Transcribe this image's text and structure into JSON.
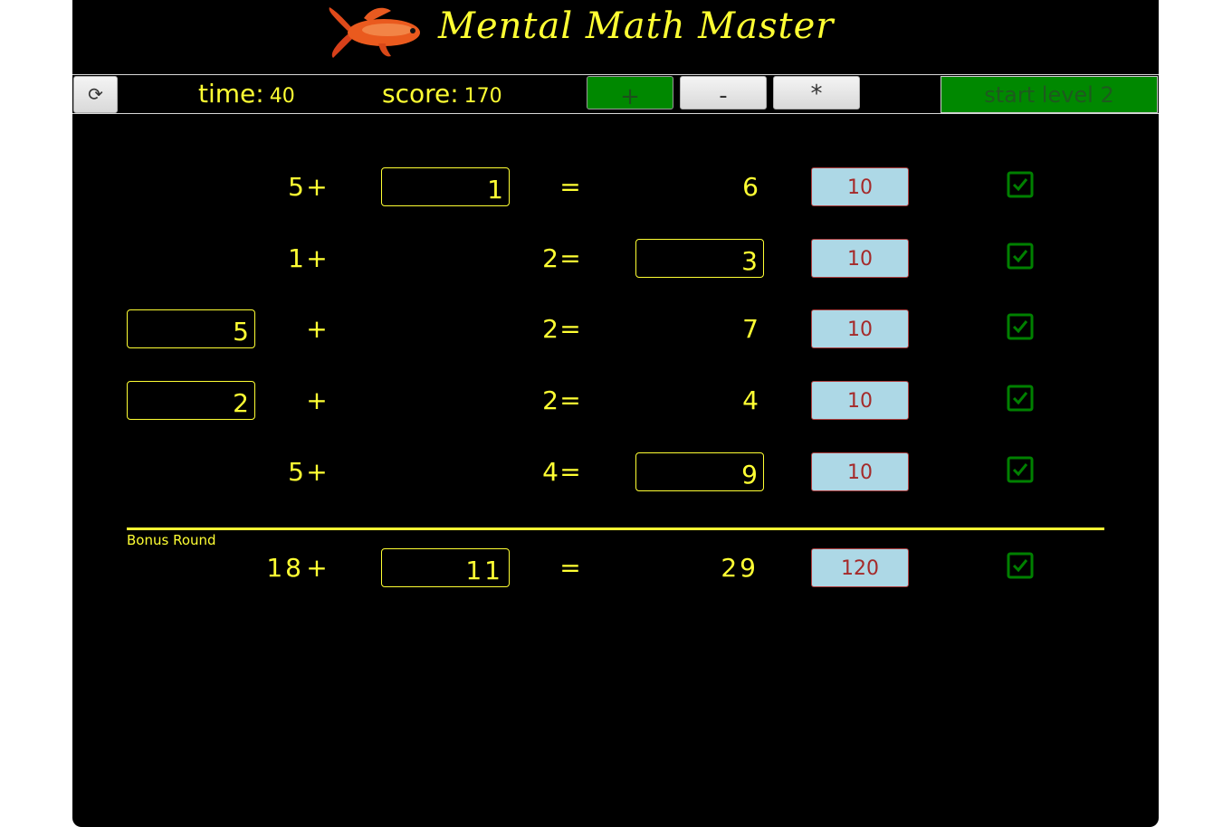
{
  "app": {
    "title": "Mental Math Master"
  },
  "toolbar": {
    "time_label": "time:",
    "time_value": "40",
    "score_label": "score:",
    "score_value": "170",
    "ops": [
      "+",
      "-",
      "*"
    ],
    "start_level_label": "start level 2"
  },
  "rows": [
    {
      "a": "5",
      "op": "+",
      "b": "1",
      "eq": "=",
      "c": "6",
      "points": "10",
      "blank": "b"
    },
    {
      "a": "1",
      "op": "+",
      "b": "2",
      "eq": "=",
      "c": "3",
      "points": "10",
      "blank": "c"
    },
    {
      "a": "5",
      "op": "+",
      "b": "2",
      "eq": "=",
      "c": "7",
      "points": "10",
      "blank": "a"
    },
    {
      "a": "2",
      "op": "+",
      "b": "2",
      "eq": "=",
      "c": "4",
      "points": "10",
      "blank": "a"
    },
    {
      "a": "5",
      "op": "+",
      "b": "4",
      "eq": "=",
      "c": "9",
      "points": "10",
      "blank": "c"
    }
  ],
  "bonus": {
    "label": "Bonus Round",
    "a": "18",
    "op": "+",
    "b": "11",
    "eq": "=",
    "c": "29",
    "points": "120",
    "blank": "b"
  },
  "colors": {
    "background": "#000000",
    "text": "#ffff33",
    "active": "#008800",
    "points_bg": "#add8e6",
    "check": "#008000"
  }
}
